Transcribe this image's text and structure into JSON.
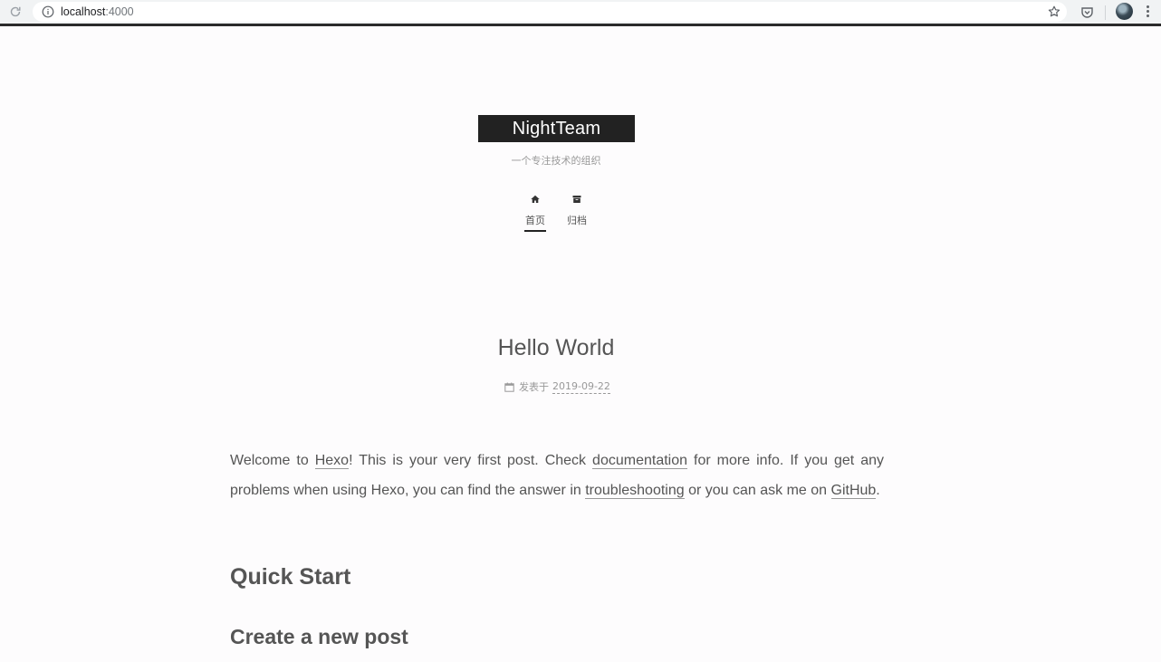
{
  "browser": {
    "url_host": "localhost",
    "url_port": ":4000"
  },
  "site": {
    "title": "NightTeam",
    "subtitle": "一个专注技术的组织",
    "menu": [
      {
        "label": "首页",
        "icon": "home-icon",
        "active": true
      },
      {
        "label": "归档",
        "icon": "archive-icon",
        "active": false
      }
    ]
  },
  "post": {
    "title": "Hello World",
    "meta_prefix": "发表于",
    "date": "2019-09-22",
    "body": {
      "t1": "Welcome to ",
      "link_hexo": "Hexo",
      "t2": "! This is your very first post. Check ",
      "link_docs": "documentation",
      "t3": " for more info. If you get any problems when using Hexo, you can find the answer in ",
      "link_trouble": "troubleshooting",
      "t4": " or you can ask me on ",
      "link_github": "GitHub",
      "t5": "."
    },
    "heading_1": "Quick Start",
    "heading_2": "Create a new post"
  },
  "colors": {
    "brand_bg": "#222222",
    "text": "#555555",
    "muted": "#999999"
  }
}
